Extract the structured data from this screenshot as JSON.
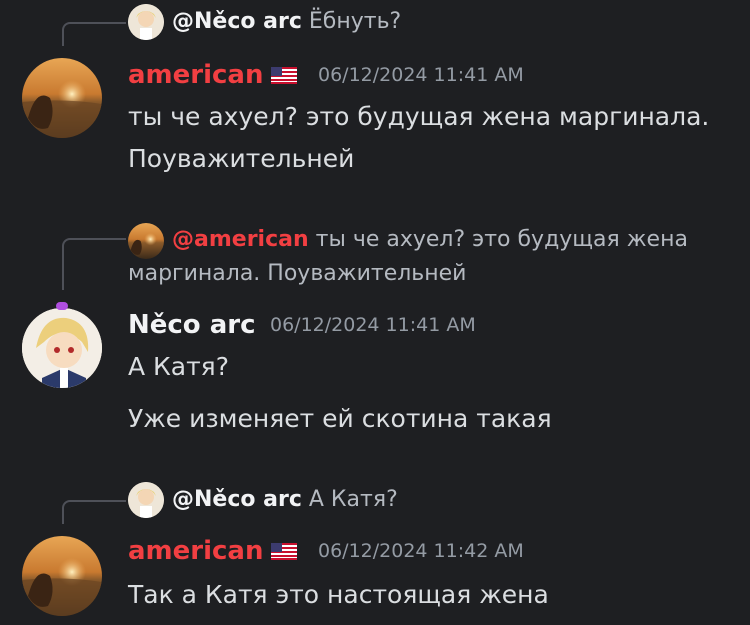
{
  "messages": [
    {
      "reply": {
        "mention": "@Něco arc",
        "content": "Ёбнуть?"
      },
      "author": "american",
      "timestamp": "06/12/2024 11:41 AM",
      "lines": [
        "ты че ахуел? это будущая жена маргинала.",
        "Поуважительней"
      ]
    },
    {
      "reply": {
        "mention": "@american",
        "content": "ты че ахуел? это будущая жена",
        "content_line2": "маргинала. Поуважительней"
      },
      "author": "Něco arc",
      "timestamp": "06/12/2024 11:41 AM",
      "lines": [
        "А Катя?",
        "Уже изменяет ей скотина такая"
      ]
    },
    {
      "reply": {
        "mention": "@Něco arc",
        "content": "А Катя?"
      },
      "author": "american",
      "timestamp": "06/12/2024 11:42 AM",
      "lines": [
        "Так а Катя это настоящая жена"
      ]
    }
  ],
  "icons": {
    "flag": "us-flag-icon"
  },
  "colors": {
    "background": "#1e1f22",
    "mention_red": "#f23f42",
    "timestamp": "#949ba4",
    "text": "#dbdee1"
  }
}
